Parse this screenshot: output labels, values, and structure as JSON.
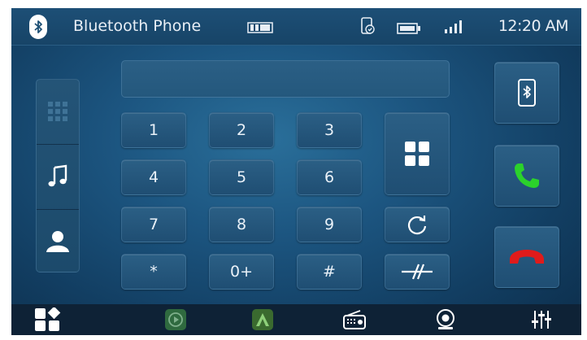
{
  "header": {
    "title": "Bluetooth Phone",
    "time": "12:20 AM",
    "icons": [
      "bluetooth-icon",
      "battery-pack-icon",
      "phone-sync-icon",
      "battery-icon",
      "signal-icon"
    ]
  },
  "dialpad": {
    "keys": [
      "1",
      "2",
      "3",
      "4",
      "5",
      "6",
      "7",
      "8",
      "9",
      "*",
      "0+",
      "#"
    ],
    "display_value": ""
  },
  "left_nav": {
    "items": [
      "keypad-icon",
      "music-note-icon",
      "contacts-icon"
    ]
  },
  "actions": {
    "icons": [
      "apps-grid-icon",
      "redial-icon",
      "clear-icon",
      "phone-bluetooth-icon",
      "call-icon",
      "hang-up-icon"
    ]
  },
  "colors": {
    "call": "#2bd22b",
    "hangup": "#e01b1b",
    "accent": "#1c5580"
  },
  "bottom_bar": {
    "icons": [
      "home-apps-icon",
      "carplay-icon",
      "android-auto-icon",
      "radio-icon",
      "camera-icon",
      "equalizer-icon"
    ]
  }
}
